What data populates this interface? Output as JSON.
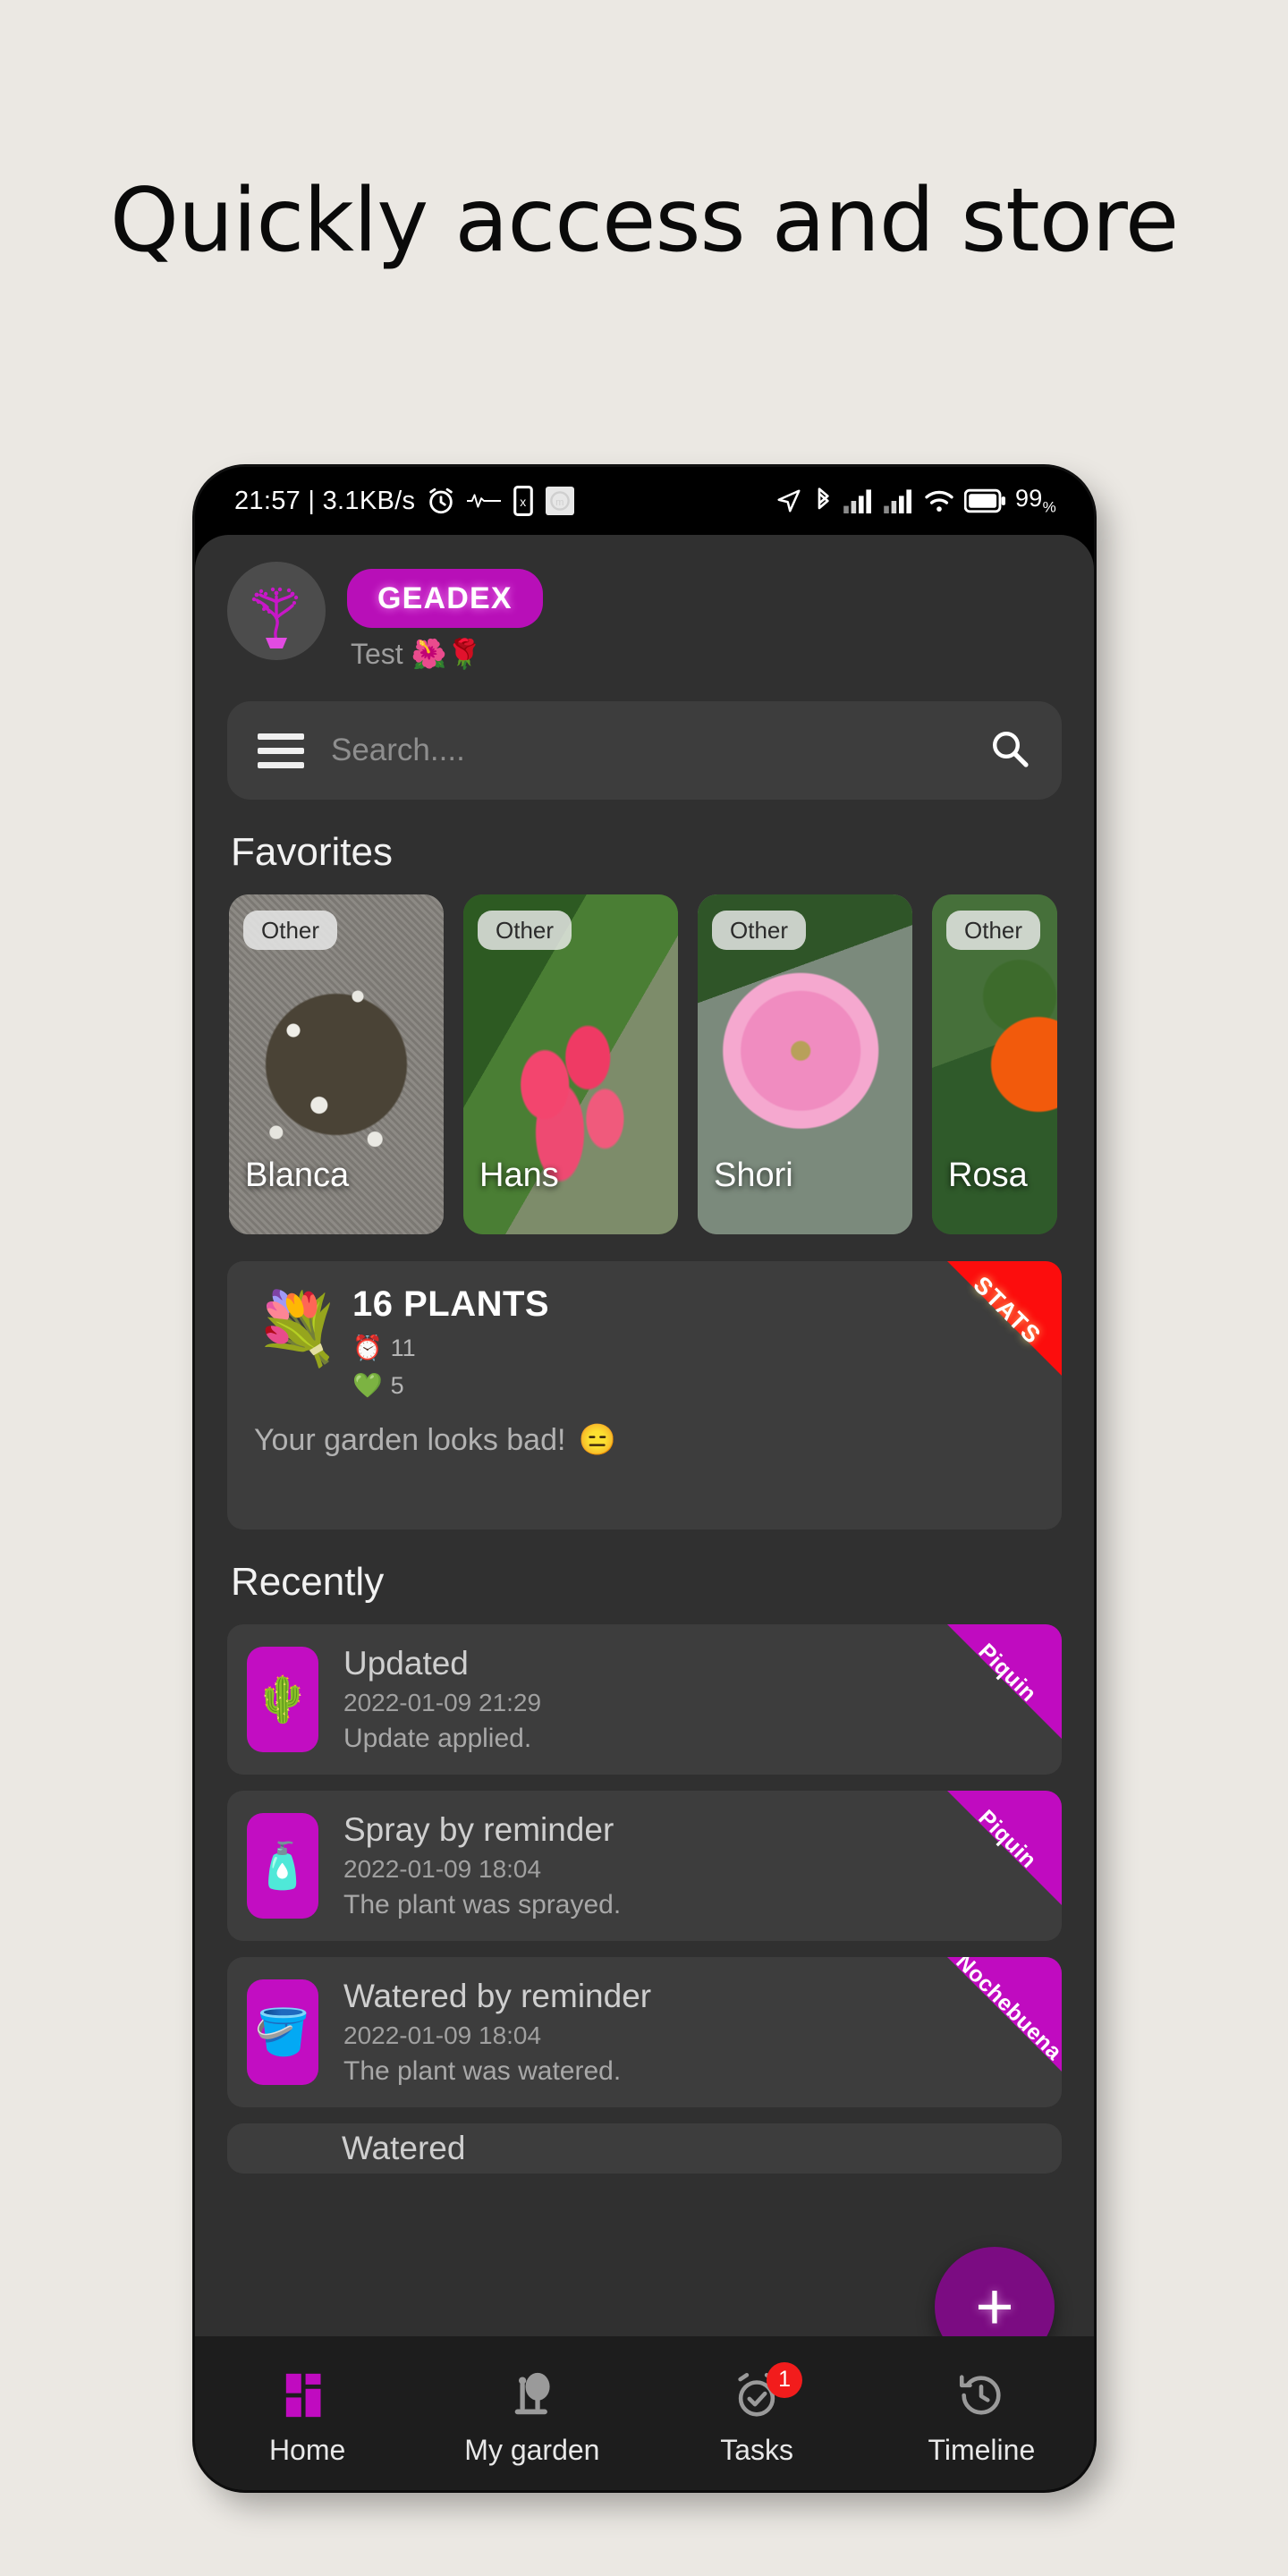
{
  "promo": {
    "title": "Quickly access and store"
  },
  "statusbar": {
    "clock": "21:57 | 3.1KB/s",
    "left_icons": [
      "alarm-icon",
      "heartbeat-icon",
      "vibrate-icon",
      "app-icon"
    ],
    "right_icons": [
      "location-icon",
      "bluetooth-icon",
      "signal-1-icon",
      "signal-2-icon",
      "wifi-icon",
      "battery-icon"
    ],
    "battery_percent": "99",
    "battery_unit": "%"
  },
  "header": {
    "avatar": "bonsai-plant-avatar",
    "brand": "GEADEX",
    "subtitle": "Test 🌺🌹"
  },
  "search": {
    "menu_icon": "hamburger-icon",
    "placeholder": "Search....",
    "search_icon": "search-icon"
  },
  "favorites": {
    "title": "Favorites",
    "cards": [
      {
        "name": "Blanca",
        "badge": "Other"
      },
      {
        "name": "Hans",
        "badge": "Other"
      },
      {
        "name": "Shori",
        "badge": "Other"
      },
      {
        "name": "Rosa",
        "badge": "Other"
      }
    ]
  },
  "stats": {
    "emoji": "💐",
    "title": "16 PLANTS",
    "alarm_icon": "⏰",
    "alarm_count": "11",
    "heart_icon": "💚",
    "heart_count": "5",
    "message": "Your garden looks bad!",
    "message_emoji": "😑",
    "ribbon": "STATS"
  },
  "recently": {
    "title": "Recently",
    "items": [
      {
        "icon": "🌵",
        "title": "Updated",
        "date": "2022-01-09 21:29",
        "desc": "Update applied.",
        "ribbon": "Piquin"
      },
      {
        "icon": "🧴",
        "title": "Spray by reminder",
        "date": "2022-01-09 18:04",
        "desc": "The plant was sprayed.",
        "ribbon": "Piquin"
      },
      {
        "icon": "🪣",
        "title": "Watered by reminder",
        "date": "2022-01-09 18:04",
        "desc": "The plant was watered.",
        "ribbon": "Nochebuena"
      },
      {
        "icon": "",
        "title": "Watered",
        "date": "",
        "desc": "",
        "ribbon": ""
      }
    ]
  },
  "fab": {
    "label": "+",
    "icon": "plus-icon"
  },
  "bottomnav": {
    "items": [
      {
        "label": "Home",
        "icon": "dashboard-icon",
        "active": true,
        "badge": ""
      },
      {
        "label": "My garden",
        "icon": "tree-icon",
        "active": false,
        "badge": ""
      },
      {
        "label": "Tasks",
        "icon": "alarm-check-icon",
        "active": false,
        "badge": "1"
      },
      {
        "label": "Timeline",
        "icon": "history-icon",
        "active": false,
        "badge": ""
      }
    ]
  },
  "colors": {
    "page_bg": "#EBE8E3",
    "app_bg": "#303030",
    "card_bg": "#3D3D3D",
    "accent_magenta": "#B80FB8",
    "accent_purple": "#7B0C82",
    "ribbon_red": "#FC0D0D",
    "badge_red": "#F21C1C",
    "nav_bg": "#1D1D1D"
  }
}
